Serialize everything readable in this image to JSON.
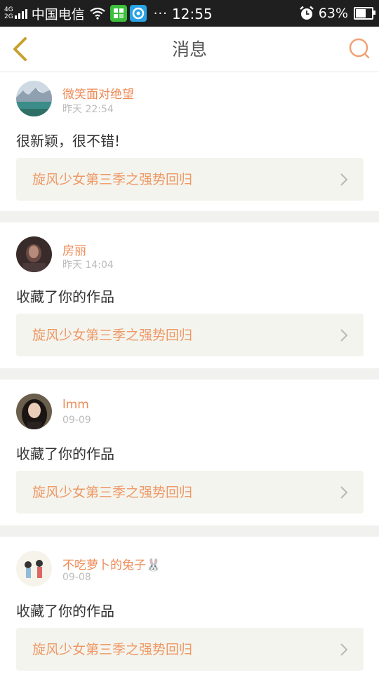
{
  "statusbar": {
    "net_top": "4G",
    "net_bottom": "2G",
    "carrier": "中国电信",
    "dots": "···",
    "time": "12:55",
    "battery_pct": "63%",
    "battery_level": 0.63,
    "icons": [
      "wifi-icon",
      "app-green-icon",
      "app-blue-icon",
      "alarm-icon",
      "battery-icon"
    ]
  },
  "nav": {
    "title": "消息",
    "back_icon": "chevron-left-icon",
    "search_icon": "search-icon",
    "accent_color": "#ee8a55"
  },
  "messages": [
    {
      "username": "微笑面对绝望",
      "time": "昨天 22:54",
      "text": "很新颖，很不错!",
      "work_title": "旋风少女第三季之强势回归"
    },
    {
      "username": "房丽",
      "time": "昨天 14:04",
      "text": "收藏了你的作品",
      "work_title": "旋风少女第三季之强势回归"
    },
    {
      "username": "lmm",
      "time": "09-09",
      "text": "收藏了你的作品",
      "work_title": "旋风少女第三季之强势回归"
    },
    {
      "username": "不吃萝卜的兔子🐰",
      "time": "09-08",
      "text": "收藏了你的作品",
      "work_title": "旋风少女第三季之强势回归"
    }
  ]
}
